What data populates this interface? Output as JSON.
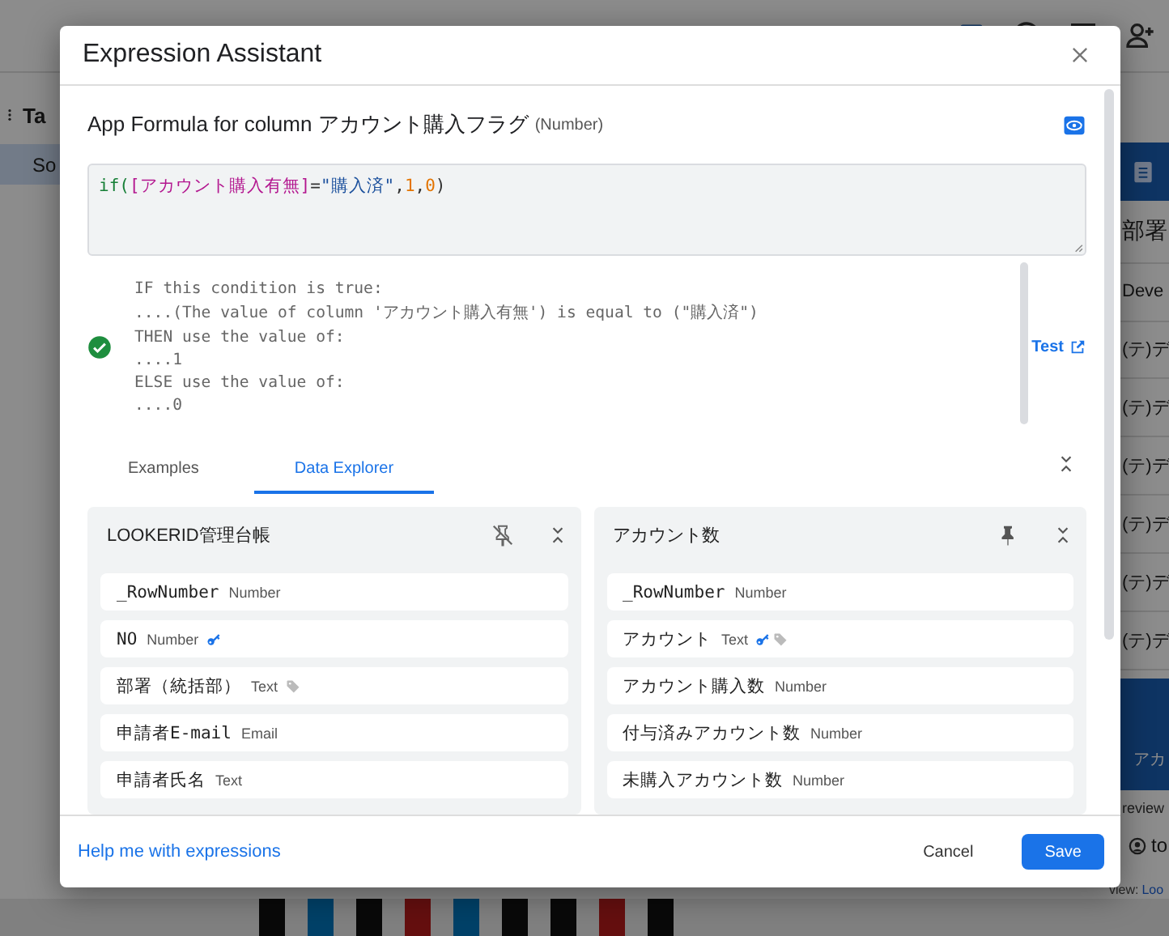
{
  "background": {
    "left_tab": "Ta",
    "left_item": "So",
    "side_panel": {
      "heading": "部署",
      "rows": [
        "Deve",
        "(テ)デ",
        "(テ)デ",
        "(テ)デ",
        "(テ)デ",
        "(テ)デ",
        "(テ)デ"
      ],
      "footer_button": "アカ",
      "preview_label": "review",
      "user": "to",
      "view_label": "view:",
      "view_link": "Loo"
    }
  },
  "dialog": {
    "title": "Expression Assistant",
    "formula_label": "App Formula for column アカウント購入フラグ",
    "formula_type": "(Number)",
    "expression": [
      {
        "kind": "function",
        "text": "if("
      },
      {
        "kind": "column",
        "text": "[アカウント購入有無]"
      },
      {
        "kind": "operator",
        "text": "="
      },
      {
        "kind": "string",
        "text": "\"購入済\""
      },
      {
        "kind": "punct",
        "text": ","
      },
      {
        "kind": "number",
        "text": "1"
      },
      {
        "kind": "punct",
        "text": ","
      },
      {
        "kind": "number",
        "text": "0"
      },
      {
        "kind": "punct",
        "text": ")"
      }
    ],
    "valid": true,
    "explanation": [
      "IF this condition is true:",
      "....(The value of column 'アカウント購入有無') is equal to (\"購入済\")",
      "THEN use the value of:",
      "....1",
      "ELSE use the value of:",
      "....0"
    ],
    "test_link": "Test",
    "tabs": [
      {
        "label": "Examples",
        "selected": false
      },
      {
        "label": "Data Explorer",
        "selected": true
      }
    ],
    "tables": [
      {
        "name": "LOOKERID管理台帳",
        "pinned": false,
        "columns": [
          {
            "name": "_RowNumber",
            "type": "Number",
            "key": false,
            "label": false
          },
          {
            "name": "NO",
            "type": "Number",
            "key": true,
            "label": false
          },
          {
            "name": "部署（統括部）",
            "type": "Text",
            "key": false,
            "label": true
          },
          {
            "name": "申請者E-mail",
            "type": "Email",
            "key": false,
            "label": false
          },
          {
            "name": "申請者氏名",
            "type": "Text",
            "key": false,
            "label": false
          }
        ]
      },
      {
        "name": "アカウント数",
        "pinned": true,
        "columns": [
          {
            "name": "_RowNumber",
            "type": "Number",
            "key": false,
            "label": false
          },
          {
            "name": "アカウント",
            "type": "Text",
            "key": true,
            "label": true
          },
          {
            "name": "アカウント購入数",
            "type": "Number",
            "key": false,
            "label": false
          },
          {
            "name": "付与済みアカウント数",
            "type": "Number",
            "key": false,
            "label": false
          },
          {
            "name": "未購入アカウント数",
            "type": "Number",
            "key": false,
            "label": false
          }
        ]
      }
    ],
    "help_link": "Help me with expressions",
    "buttons": [
      {
        "kind": "secondary",
        "label": "Cancel"
      },
      {
        "kind": "primary",
        "label": "Save"
      }
    ]
  }
}
